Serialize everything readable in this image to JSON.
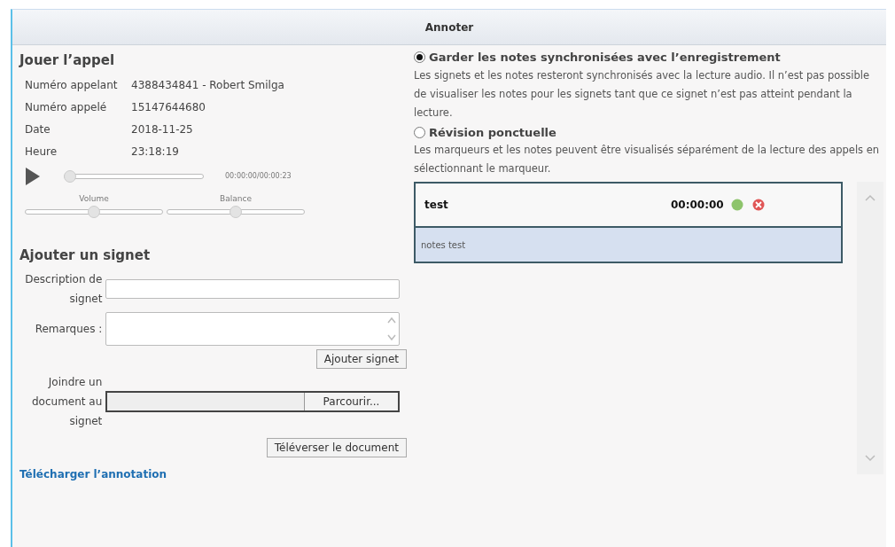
{
  "header": {
    "title": "Annoter"
  },
  "player": {
    "title": "Jouer l’appel",
    "info": [
      {
        "label": "Numéro appelant",
        "value": "4388434841 - Robert Smilga"
      },
      {
        "label": "Numéro appelé",
        "value": "15147644680"
      },
      {
        "label": "Date",
        "value": "2018-11-25"
      },
      {
        "label": "Heure",
        "value": "23:18:19"
      }
    ],
    "progress": {
      "level": 0,
      "reading": "00:00:00/00:00:23"
    },
    "sliders": [
      {
        "label": "Volume",
        "level": 0.5
      },
      {
        "label": "Balance",
        "level": 0.5
      }
    ]
  },
  "bookmark_form": {
    "title": "Ajouter un signet",
    "description_label": "Description de signet",
    "remarks_label": "Remarques :",
    "add_button": "Ajouter signet",
    "attach_label": "Joindre un document au signet",
    "browse_button": "Parcourir...",
    "upload_button": "Téléverser le document"
  },
  "download_link": "Télécharger l’annotation",
  "modes": [
    {
      "label": "Garder les notes synchronisées avec l’enregistrement",
      "selected": true,
      "description": "Les signets et les notes resteront synchronisés avec la lecture audio. Il n’est pas possible de visualiser les notes pour les signets tant que ce signet n’est pas atteint pendant la lecture."
    },
    {
      "label": "Révision ponctuelle",
      "selected": false,
      "description": "Les marqueurs et les notes peuvent être visualisés séparément de la lecture des appels en sélectionnant le marqueur."
    }
  ],
  "bookmarks": [
    {
      "title": "test",
      "time": "00:00:00",
      "notes": "notes test"
    }
  ]
}
